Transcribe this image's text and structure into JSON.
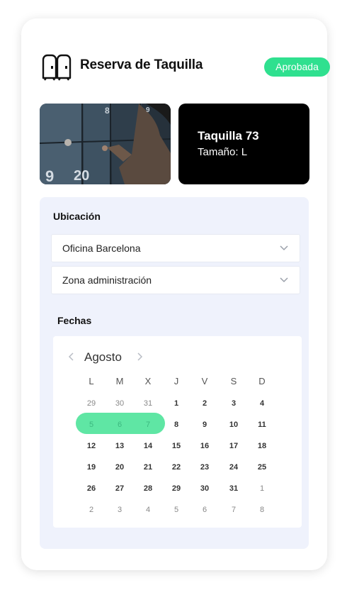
{
  "header": {
    "title": "Reserva de Taquilla",
    "status": "Aprobada",
    "icon": "locker-icon"
  },
  "locker": {
    "name": "Taquilla 73",
    "size_text": "Tamaño: L",
    "photo_numbers": [
      "9",
      "20",
      "8",
      "9"
    ]
  },
  "location": {
    "label": "Ubicación",
    "office": "Oficina Barcelona",
    "zone": "Zona administración"
  },
  "dates": {
    "label": "Fechas",
    "month": "Agosto",
    "weekdays": [
      "L",
      "M",
      "X",
      "J",
      "V",
      "S",
      "D"
    ],
    "weeks": [
      [
        "29",
        "30",
        "31",
        "1",
        "2",
        "3",
        "4"
      ],
      [
        "5",
        "6",
        "7",
        "8",
        "9",
        "10",
        "11"
      ],
      [
        "12",
        "13",
        "14",
        "15",
        "16",
        "17",
        "18"
      ],
      [
        "19",
        "20",
        "21",
        "22",
        "23",
        "24",
        "25"
      ],
      [
        "26",
        "27",
        "28",
        "29",
        "30",
        "31",
        "1"
      ],
      [
        "2",
        "3",
        "4",
        "5",
        "6",
        "7",
        "8"
      ]
    ],
    "selected_range": [
      "5",
      "6",
      "7"
    ]
  },
  "colors": {
    "accent": "#2fe08f",
    "range": "#5fe6a4",
    "panel": "#eff2fc"
  }
}
